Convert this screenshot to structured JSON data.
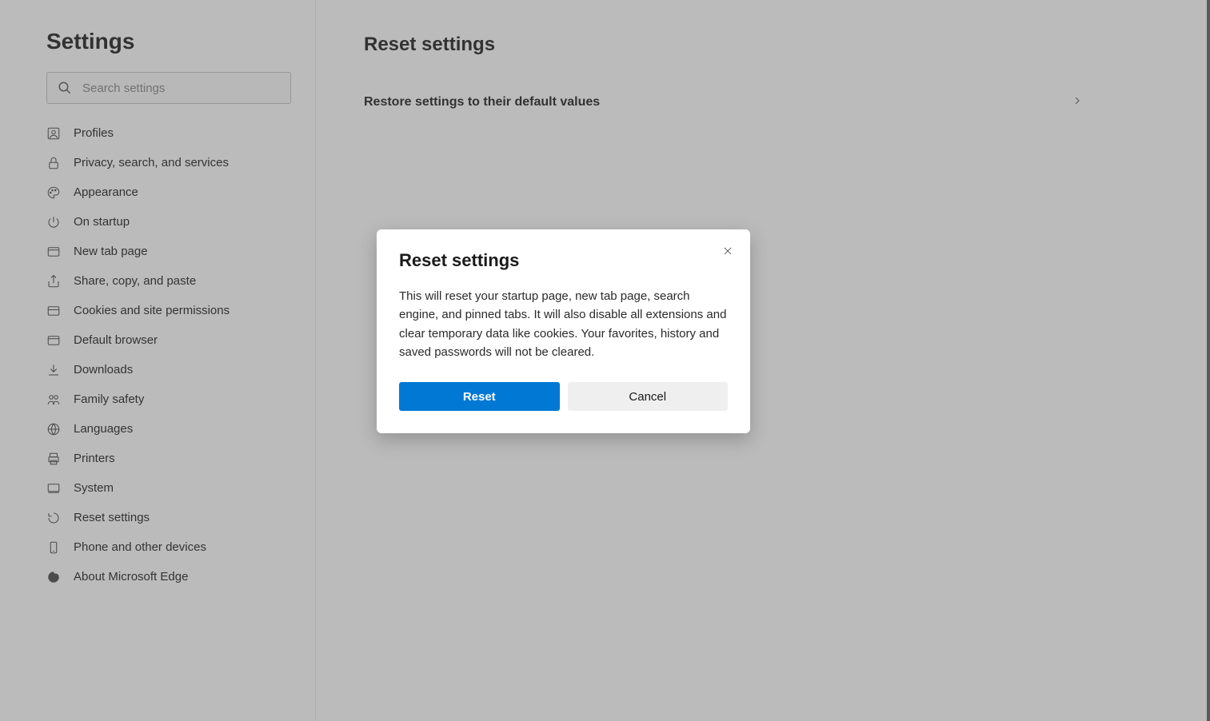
{
  "sidebar": {
    "title": "Settings",
    "search_placeholder": "Search settings",
    "items": [
      {
        "label": "Profiles",
        "icon": "profile-icon"
      },
      {
        "label": "Privacy, search, and services",
        "icon": "lock-icon"
      },
      {
        "label": "Appearance",
        "icon": "appearance-icon"
      },
      {
        "label": "On startup",
        "icon": "power-icon"
      },
      {
        "label": "New tab page",
        "icon": "new-tab-icon"
      },
      {
        "label": "Share, copy, and paste",
        "icon": "share-icon"
      },
      {
        "label": "Cookies and site permissions",
        "icon": "cookies-icon"
      },
      {
        "label": "Default browser",
        "icon": "default-browser-icon"
      },
      {
        "label": "Downloads",
        "icon": "download-icon"
      },
      {
        "label": "Family safety",
        "icon": "family-icon"
      },
      {
        "label": "Languages",
        "icon": "language-icon"
      },
      {
        "label": "Printers",
        "icon": "printer-icon"
      },
      {
        "label": "System",
        "icon": "system-icon"
      },
      {
        "label": "Reset settings",
        "icon": "reset-icon"
      },
      {
        "label": "Phone and other devices",
        "icon": "phone-icon"
      },
      {
        "label": "About Microsoft Edge",
        "icon": "edge-icon"
      }
    ]
  },
  "main": {
    "title": "Reset settings",
    "row_label": "Restore settings to their default values"
  },
  "dialog": {
    "title": "Reset settings",
    "body": "This will reset your startup page, new tab page, search engine, and pinned tabs. It will also disable all extensions and clear temporary data like cookies. Your favorites, history and saved passwords will not be cleared.",
    "reset_label": "Reset",
    "cancel_label": "Cancel"
  }
}
